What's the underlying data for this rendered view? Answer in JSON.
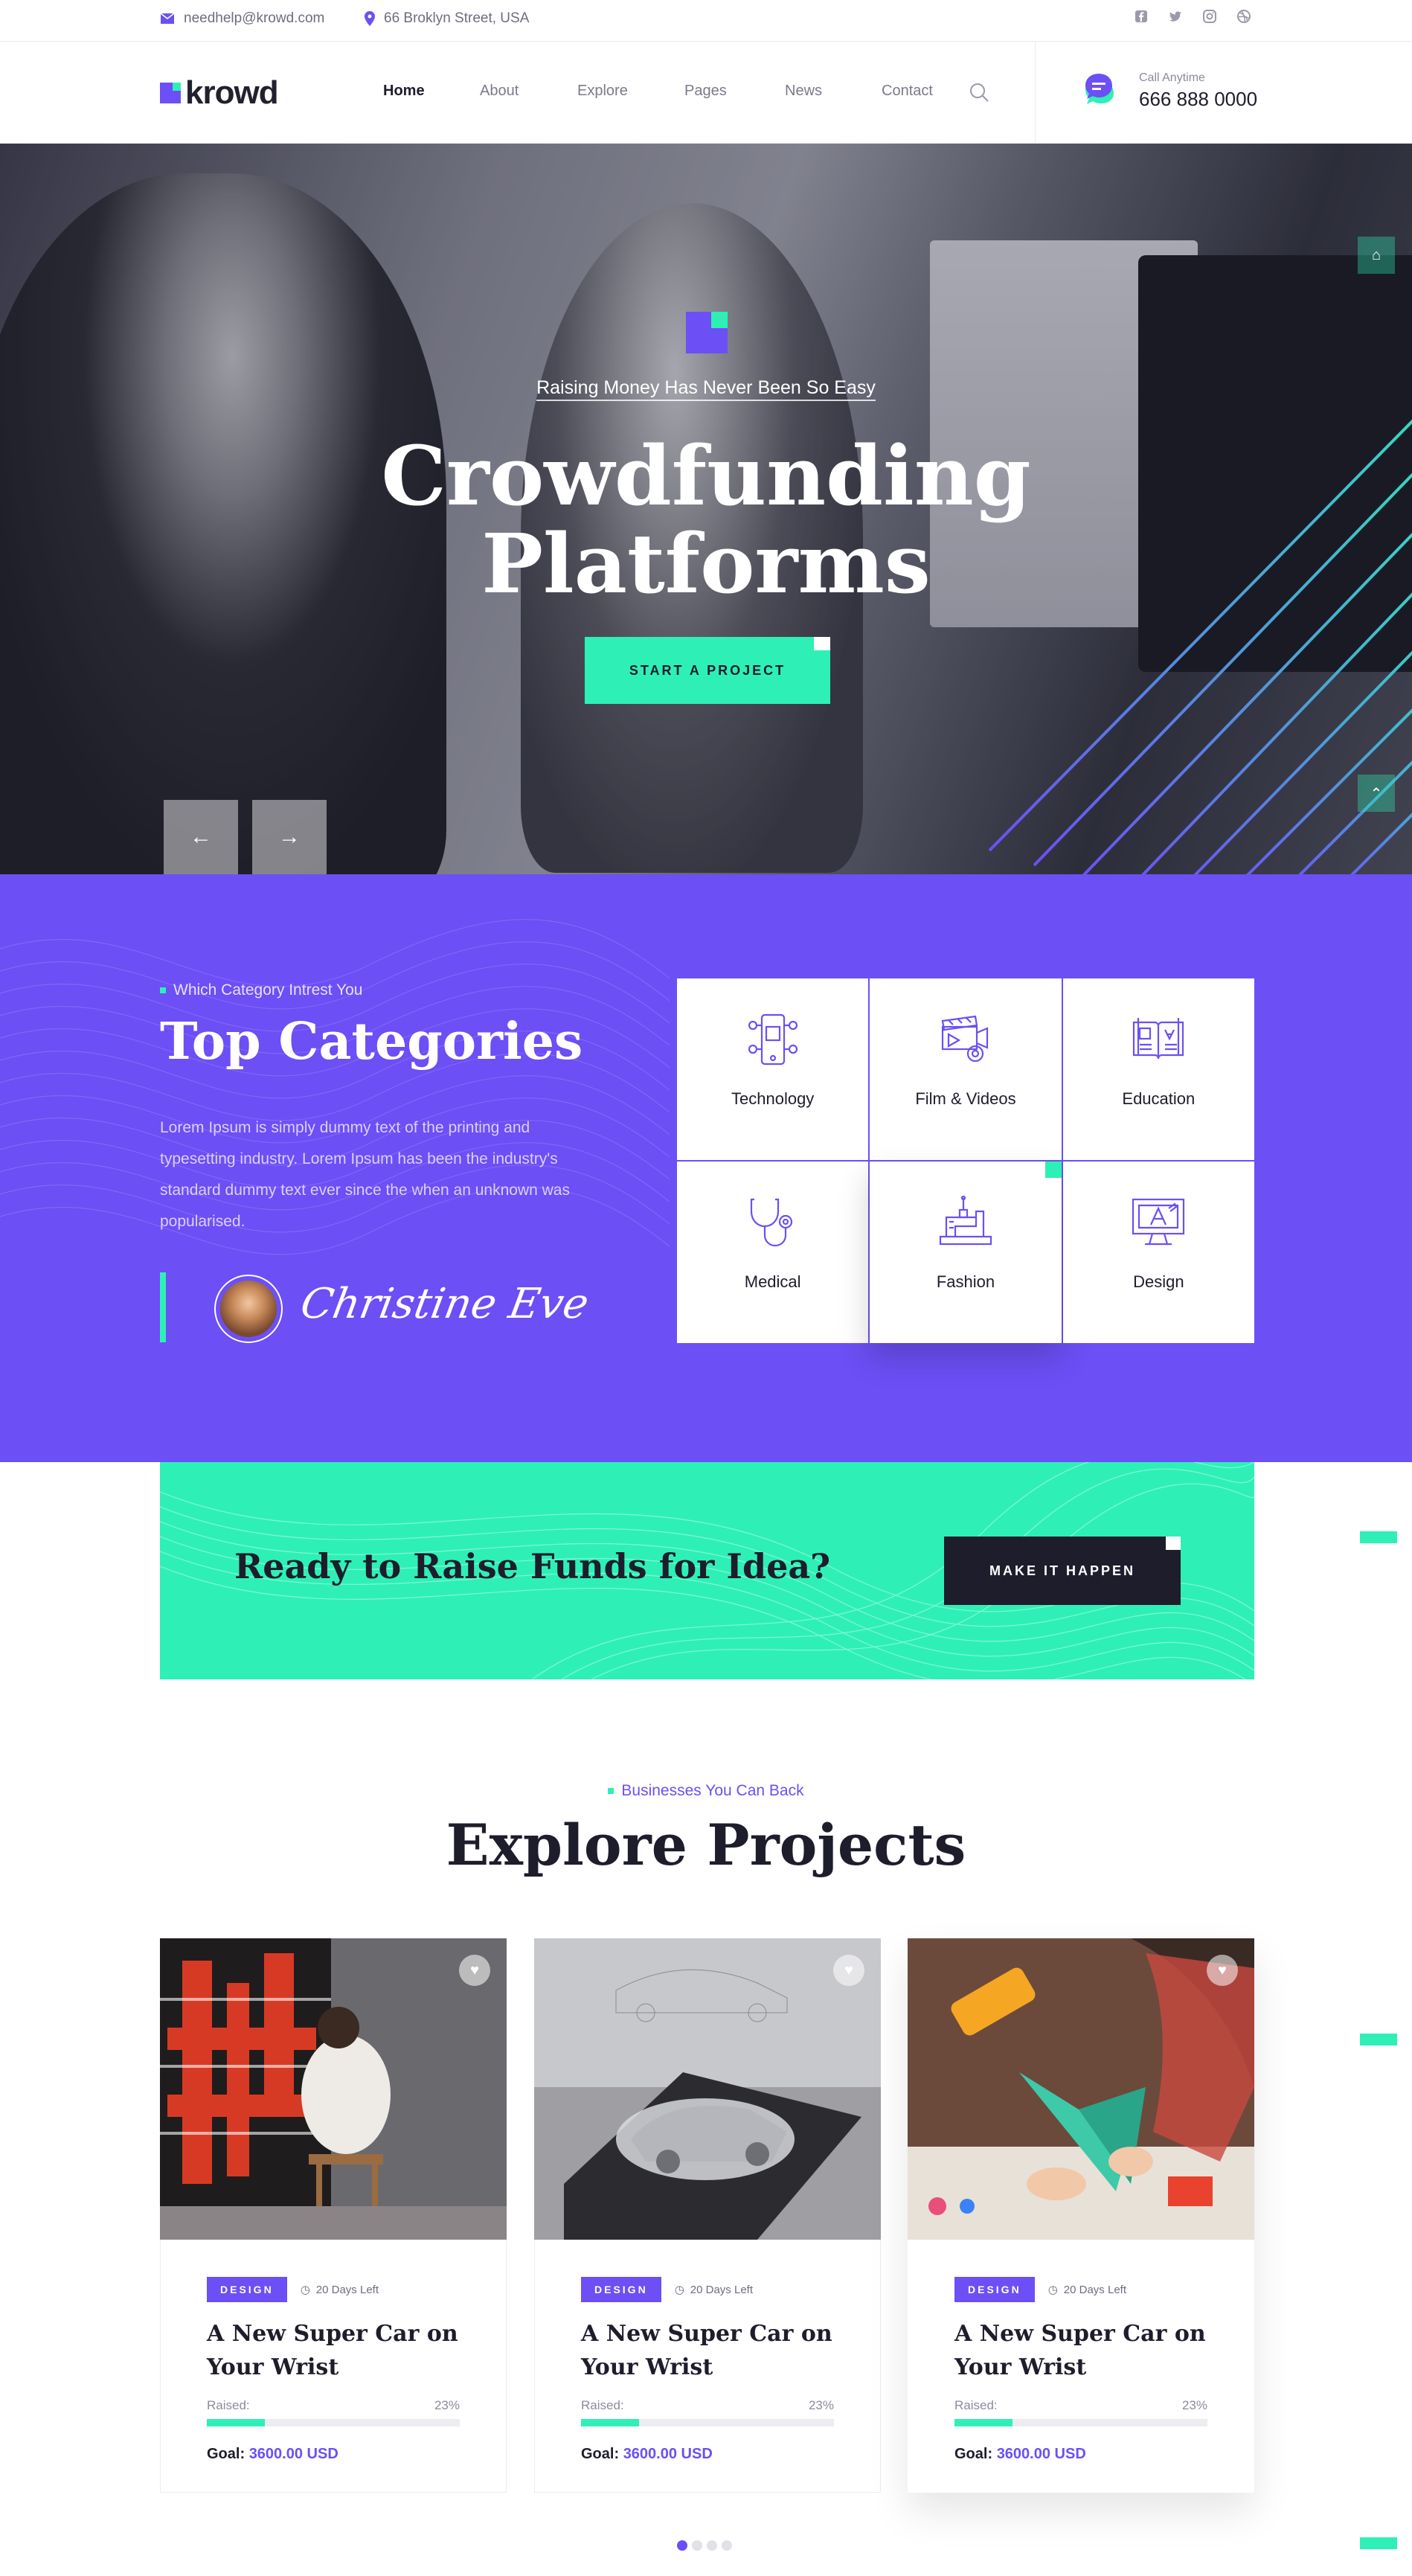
{
  "topbar": {
    "email": "needhelp@krowd.com",
    "address": "66 Broklyn Street, USA",
    "social": [
      "facebook-icon",
      "twitter-icon",
      "instagram-icon",
      "dribbble-icon"
    ]
  },
  "header": {
    "logo": "krowd",
    "nav": [
      "Home",
      "About",
      "Explore",
      "Pages",
      "News",
      "Contact"
    ],
    "active_nav": "Home",
    "call_label": "Call Anytime",
    "call_number": "666 888 0000"
  },
  "hero": {
    "subtitle": "Raising Money Has Never Been So Easy",
    "title_line1": "Crowdfunding",
    "title_line2": "Platforms",
    "cta": "START A PROJECT",
    "prev_arrow": "←",
    "next_arrow": "→"
  },
  "categories": {
    "eyebrow": "Which Category Intrest You",
    "title": "Top Categories",
    "description": "Lorem Ipsum is simply dummy text of the printing and typesetting industry. Lorem Ipsum has been the industry's standard dummy text ever since the when an unknown was popularised.",
    "signature": "Christine Eve",
    "items": [
      {
        "label": "Technology",
        "icon": "technology-icon"
      },
      {
        "label": "Film & Videos",
        "icon": "film-camera-icon"
      },
      {
        "label": "Education",
        "icon": "book-icon"
      },
      {
        "label": "Medical",
        "icon": "stethoscope-icon"
      },
      {
        "label": "Fashion",
        "icon": "sewing-machine-icon"
      },
      {
        "label": "Design",
        "icon": "design-monitor-icon"
      }
    ]
  },
  "raise": {
    "title": "Ready to Raise Funds for Idea?",
    "button": "MAKE IT HAPPEN"
  },
  "projects": {
    "eyebrow": "Businesses You Can Back",
    "title": "Explore Projects",
    "cards": [
      {
        "badge": "DESIGN",
        "days": "20 Days Left",
        "title": "A New Super Car on Your Wrist",
        "raised_label": "Raised:",
        "percent": "23%",
        "progress": 0.23,
        "goal_label": "Goal:",
        "goal_value": "3600.00 USD"
      },
      {
        "badge": "DESIGN",
        "days": "20 Days Left",
        "title": "A New Super Car on Your Wrist",
        "raised_label": "Raised:",
        "percent": "23%",
        "progress": 0.23,
        "goal_label": "Goal:",
        "goal_value": "3600.00 USD"
      },
      {
        "badge": "DESIGN",
        "days": "20 Days Left",
        "title": "A New Super Car on Your Wrist",
        "raised_label": "Raised:",
        "percent": "23%",
        "progress": 0.23,
        "goal_label": "Goal:",
        "goal_value": "3600.00 USD"
      }
    ]
  },
  "colors": {
    "accent": "#6c4ff5",
    "mint": "#2ef0b6",
    "dark": "#1d1d2c"
  }
}
